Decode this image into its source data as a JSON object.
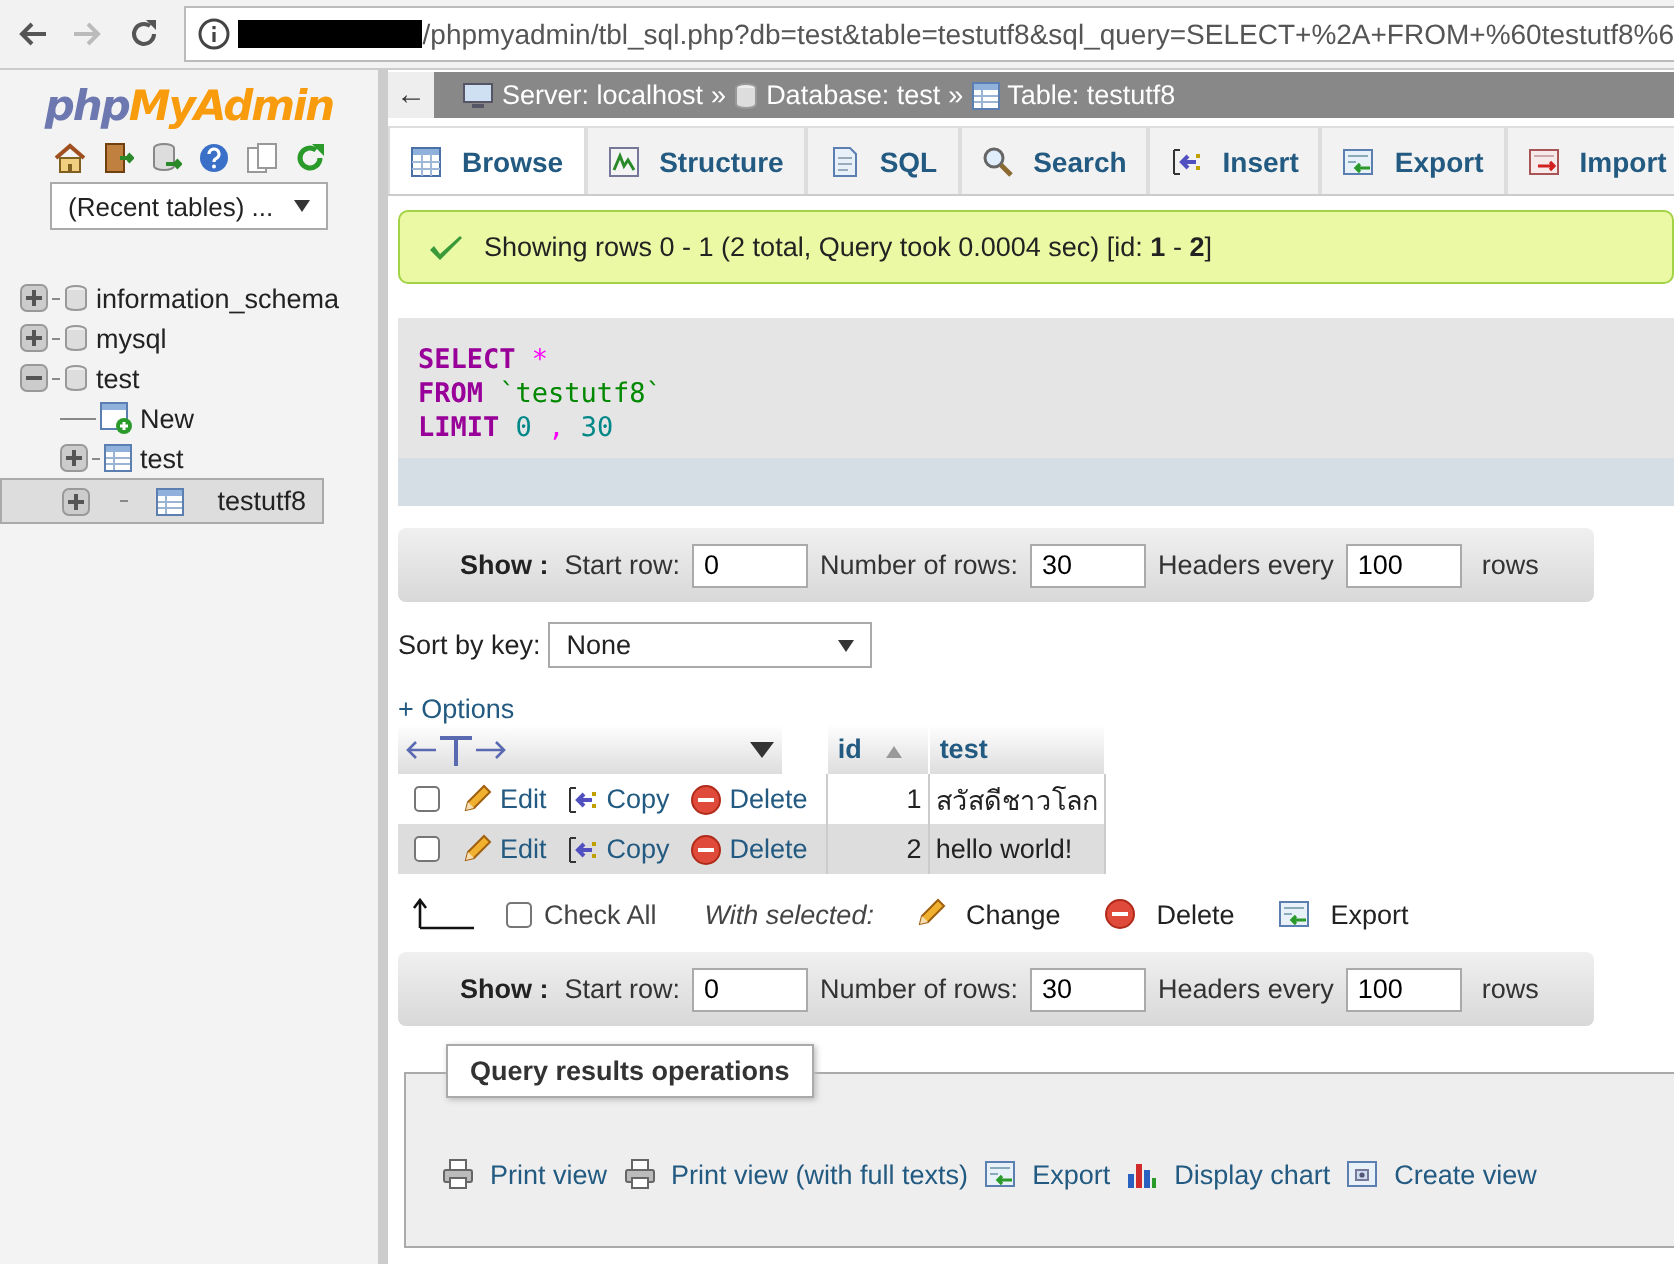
{
  "browser": {
    "url": "/phpmyadmin/tbl_sql.php?db=test&table=testutf8&sql_query=SELECT+%2A+FROM+%60testutf8%6"
  },
  "sidebar": {
    "logo": [
      "php",
      "MyAdmin"
    ],
    "recent_tables": "(Recent tables) ...",
    "tree": [
      {
        "label": "information_schema",
        "kind": "db",
        "expanded": false,
        "selected": false
      },
      {
        "label": "mysql",
        "kind": "db",
        "expanded": false,
        "selected": false
      },
      {
        "label": "test",
        "kind": "db",
        "expanded": true,
        "selected": false,
        "children": [
          {
            "label": "New",
            "kind": "new",
            "selected": false
          },
          {
            "label": "test",
            "kind": "table",
            "expanded": false,
            "selected": false
          },
          {
            "label": "testutf8",
            "kind": "table",
            "expanded": false,
            "selected": true
          }
        ]
      }
    ]
  },
  "breadcrumb": {
    "back": "←",
    "separator": "»",
    "items": [
      {
        "label": "Server: localhost",
        "kind": "server"
      },
      {
        "label": "Database: test",
        "kind": "database"
      },
      {
        "label": "Table: testutf8",
        "kind": "table"
      }
    ]
  },
  "tabs": [
    {
      "label": "Browse",
      "kind": "browse",
      "selected": true
    },
    {
      "label": "Structure",
      "kind": "structure",
      "selected": false
    },
    {
      "label": "SQL",
      "kind": "sql",
      "selected": false
    },
    {
      "label": "Search",
      "kind": "search",
      "selected": false
    },
    {
      "label": "Insert",
      "kind": "insert",
      "selected": false
    },
    {
      "label": "Export",
      "kind": "export",
      "selected": false
    },
    {
      "label": "Import",
      "kind": "import",
      "selected": false
    }
  ],
  "message": "Showing rows 0 - 1 (2 total, Query took 0.0004 sec) [id: **1** - **2**]",
  "sql": [
    [
      {
        "text": "SELECT",
        "kind": "keyword"
      },
      {
        "text": "*",
        "kind": "operator"
      }
    ],
    [
      {
        "text": "FROM",
        "kind": "keyword"
      },
      {
        "text": "`testutf8`",
        "kind": "identifier"
      }
    ],
    [
      {
        "text": "LIMIT",
        "kind": "keyword"
      },
      {
        "text": "0",
        "kind": "number"
      },
      {
        "text": ",",
        "kind": "operator"
      },
      {
        "text": "30",
        "kind": "number"
      }
    ]
  ],
  "navigation_top": {
    "show": "Show :",
    "start_label": "Start row:",
    "start": "0",
    "count_label": "Number of rows:",
    "count": "30",
    "headers_label": "Headers every",
    "headers": "100",
    "rows": "rows"
  },
  "sort": {
    "label": "Sort by key:",
    "value": "None"
  },
  "options": "+ Options",
  "table": {
    "columns": [
      {
        "label": "id",
        "sorted_ascending": true
      },
      {
        "label": "test",
        "sorted_ascending": false
      }
    ],
    "rows": [
      {
        "checked": false,
        "actions": [
          "Edit",
          "Copy",
          "Delete"
        ],
        "id": "1",
        "test": "สวัสดีชาวโลก"
      },
      {
        "checked": false,
        "actions": [
          "Edit",
          "Copy",
          "Delete"
        ],
        "id": "2",
        "test": "hello world!"
      }
    ]
  },
  "bulk": {
    "check_all": "Check All",
    "checked": false,
    "with_selected": "With selected:",
    "actions": [
      {
        "label": "Change",
        "kind": "change"
      },
      {
        "label": "Delete",
        "kind": "delete"
      },
      {
        "label": "Export",
        "kind": "export"
      }
    ]
  },
  "navigation_bottom": {
    "show": "Show :",
    "start_label": "Start row:",
    "start": "0",
    "count_label": "Number of rows:",
    "count": "30",
    "headers_label": "Headers every",
    "headers": "100",
    "rows": "rows"
  },
  "operations": {
    "legend": "Query results operations",
    "links": [
      {
        "label": "Print view",
        "kind": "print"
      },
      {
        "label": "Print view (with full texts)",
        "kind": "print"
      },
      {
        "label": "Export",
        "kind": "export"
      },
      {
        "label": "Display chart",
        "kind": "chart"
      },
      {
        "label": "Create view",
        "kind": "view"
      }
    ]
  }
}
